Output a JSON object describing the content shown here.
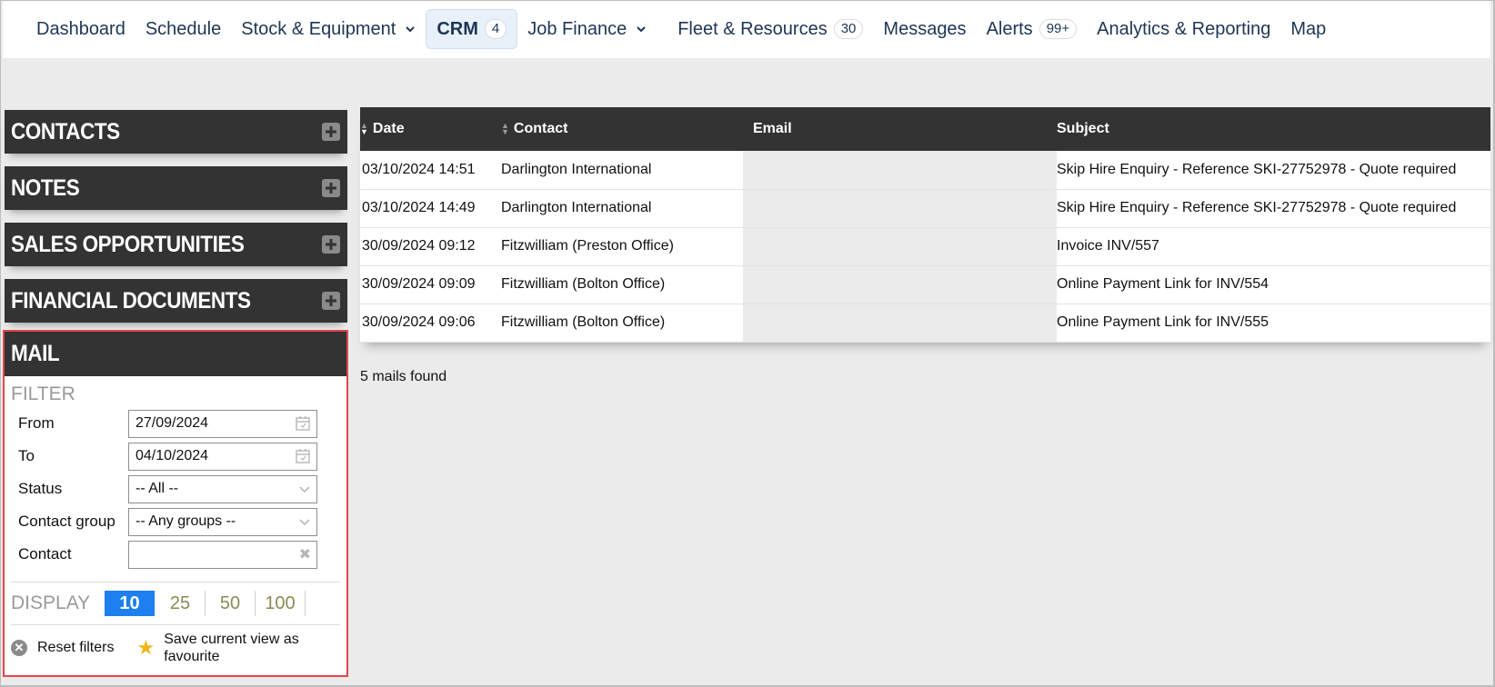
{
  "nav": {
    "items": [
      {
        "label": "Dashboard"
      },
      {
        "label": "Schedule"
      },
      {
        "label": "Stock & Equipment",
        "dropdown": true
      },
      {
        "label": "CRM",
        "badge": "4",
        "active": true
      },
      {
        "label": "Job Finance",
        "dropdown": true
      },
      {
        "label": "Fleet & Resources",
        "badge": "30"
      },
      {
        "label": "Messages"
      },
      {
        "label": "Alerts",
        "badge": "99+"
      },
      {
        "label": "Analytics & Reporting"
      },
      {
        "label": "Map"
      }
    ]
  },
  "sidebar": {
    "panels": [
      {
        "title": "CONTACTS"
      },
      {
        "title": "NOTES"
      },
      {
        "title": "SALES OPPORTUNITIES"
      },
      {
        "title": "FINANCIAL DOCUMENTS"
      }
    ],
    "mail": {
      "title": "MAIL",
      "filter_title": "FILTER",
      "from_label": "From",
      "from_value": "27/09/2024",
      "to_label": "To",
      "to_value": "04/10/2024",
      "status_label": "Status",
      "status_value": "-- All --",
      "group_label": "Contact group",
      "group_value": "-- Any groups --",
      "contact_label": "Contact",
      "contact_value": "",
      "display_label": "DISPLAY",
      "page_sizes": [
        "10",
        "25",
        "50",
        "100"
      ],
      "page_size_selected": "10",
      "reset_label": "Reset filters",
      "favourite_label": "Save current view as favourite"
    }
  },
  "table": {
    "headers": {
      "date": "Date",
      "contact": "Contact",
      "email": "Email",
      "subject": "Subject"
    },
    "rows": [
      {
        "date": "03/10/2024 14:51",
        "contact": "Darlington International",
        "email": "",
        "subject": "Skip Hire Enquiry - Reference SKI-27752978 - Quote required"
      },
      {
        "date": "03/10/2024 14:49",
        "contact": "Darlington International",
        "email": "",
        "subject": "Skip Hire Enquiry - Reference SKI-27752978 - Quote required"
      },
      {
        "date": "30/09/2024 09:12",
        "contact": "Fitzwilliam (Preston Office)",
        "email": "",
        "subject": "Invoice INV/557"
      },
      {
        "date": "30/09/2024 09:09",
        "contact": "Fitzwilliam (Bolton Office)",
        "email": "",
        "subject": "Online Payment Link for INV/554"
      },
      {
        "date": "30/09/2024 09:06",
        "contact": "Fitzwilliam (Bolton Office)",
        "email": "",
        "subject": "Online Payment Link for INV/555"
      }
    ],
    "found_text": "5 mails found"
  },
  "colors": {
    "header_bg": "#333333",
    "nav_text": "#1f3554",
    "accent": "#1e7ff0",
    "highlight_border": "#e0474c",
    "star": "#f2b61b"
  }
}
